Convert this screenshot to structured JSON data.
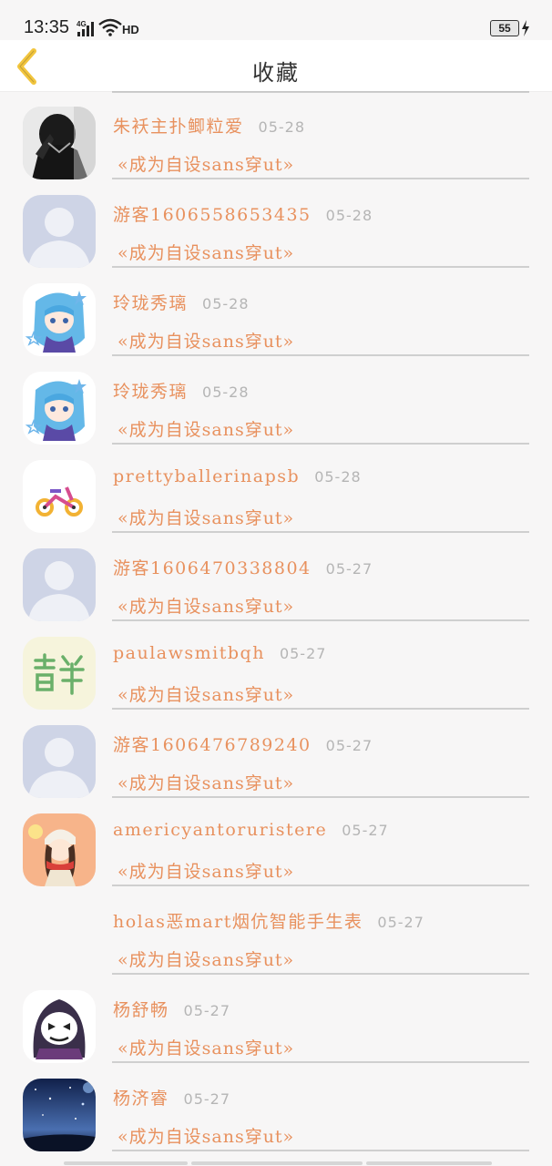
{
  "status_bar": {
    "time": "13:35",
    "network": "4G",
    "hd": "HD",
    "battery": "55"
  },
  "header": {
    "title": "收藏",
    "back_icon": "chevron-left-icon",
    "accent_color": "#f2c53d"
  },
  "list": {
    "items": [
      {
        "name": "朱袄主扑鲫粒爱",
        "date": "05-28",
        "title": "«成为自设sans穿ut»",
        "avatar": "dark-photo"
      },
      {
        "name": "游客1606558653435",
        "date": "05-28",
        "title": "«成为自设sans穿ut»",
        "avatar": "default-person"
      },
      {
        "name": "玲珑秀璃",
        "date": "05-28",
        "title": "«成为自设sans穿ut»",
        "avatar": "anime-blue-girl"
      },
      {
        "name": "玲珑秀璃",
        "date": "05-28",
        "title": "«成为自设sans穿ut»",
        "avatar": "anime-blue-girl"
      },
      {
        "name": "prettyballerinapsb",
        "date": "05-28",
        "title": "«成为自设sans穿ut»",
        "avatar": "tricycle"
      },
      {
        "name": "游客1606470338804",
        "date": "05-27",
        "title": "«成为自设sans穿ut»",
        "avatar": "default-person"
      },
      {
        "name": "paulawsmitbqh",
        "date": "05-27",
        "title": "«成为自设sans穿ut»",
        "avatar": "green-glyph"
      },
      {
        "name": "游客1606476789240",
        "date": "05-27",
        "title": "«成为自设sans穿ut»",
        "avatar": "default-person"
      },
      {
        "name": "americyantoruristere",
        "date": "05-27",
        "title": "«成为自设sans穿ut»",
        "avatar": "girl-scarf"
      },
      {
        "name": "holas恶mart烟伉智能手生表",
        "date": "05-27",
        "title": "«成为自设sans穿ut»",
        "avatar": "none"
      },
      {
        "name": "杨舒畅",
        "date": "05-27",
        "title": "«成为自设sans穿ut»",
        "avatar": "skull-hood"
      },
      {
        "name": "杨济睿",
        "date": "05-27",
        "title": "«成为自设sans穿ut»",
        "avatar": "night-sky"
      }
    ]
  }
}
